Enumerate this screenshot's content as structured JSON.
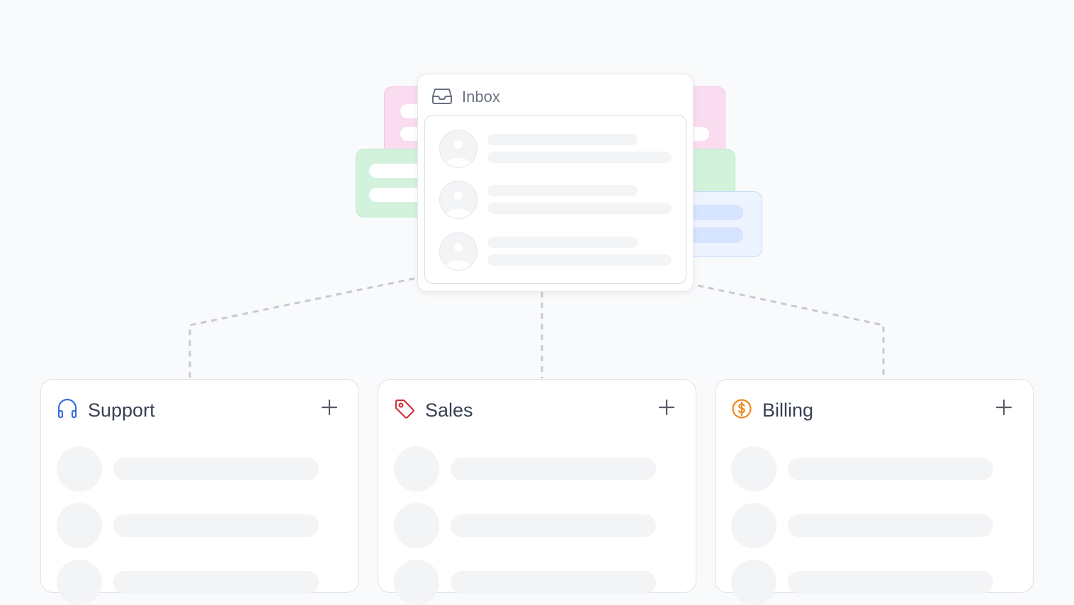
{
  "inbox": {
    "title": "Inbox",
    "icon": "inbox-icon",
    "message_count": 3
  },
  "queues": [
    {
      "title": "Support",
      "icon": "headset-icon",
      "accent": "#3b6fd8",
      "add_label": "+"
    },
    {
      "title": "Sales",
      "icon": "tag-icon",
      "accent": "#d0343b",
      "add_label": "+"
    },
    {
      "title": "Billing",
      "icon": "dollar-circle-icon",
      "accent": "#ee8a22",
      "add_label": "+"
    }
  ],
  "colors": {
    "background": "#f9fafb",
    "placeholder": "#f3f4f6",
    "deco_pink": "#f9dcef",
    "deco_green": "#d3f2dc",
    "deco_blue": "#eef4ff",
    "connector": "#c8cacf"
  }
}
